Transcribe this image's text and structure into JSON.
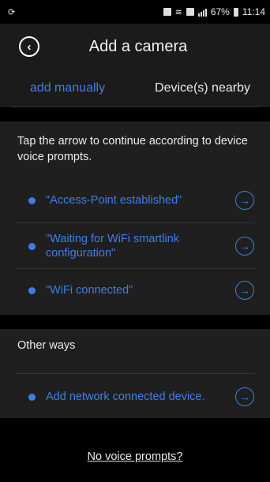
{
  "status_bar": {
    "left_icon": "sync-icon",
    "battery": "67%",
    "time": "11:14"
  },
  "header": {
    "back_icon": "chevron-left-icon",
    "title": "Add a camera"
  },
  "tabs": [
    {
      "label": "add manually",
      "active": true
    },
    {
      "label": "Device(s) nearby",
      "active": false
    }
  ],
  "instructions": "Tap the arrow to continue according to device voice prompts.",
  "prompts": [
    {
      "label": "\"Access-Point established\""
    },
    {
      "label": "\"Waiting for WiFi smartlink configuration\""
    },
    {
      "label": "\"WiFi connected\""
    }
  ],
  "other": {
    "title": "Other ways",
    "items": [
      {
        "label": "Add network connected device."
      }
    ]
  },
  "bottom_link": "No voice prompts?",
  "colors": {
    "accent": "#3e7ee6",
    "panel": "#1f1f1f",
    "background": "#000000"
  }
}
